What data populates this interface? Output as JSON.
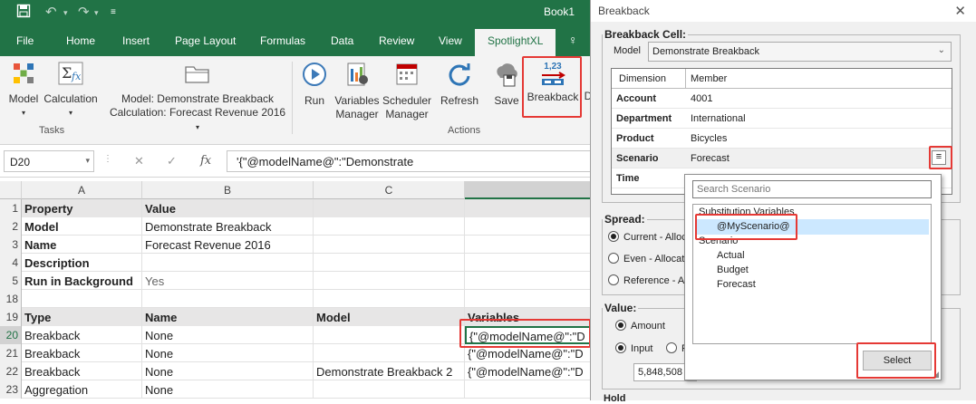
{
  "titlebar": {
    "book": "Book1"
  },
  "ribbon_tabs": [
    "File",
    "Home",
    "Insert",
    "Page Layout",
    "Formulas",
    "Data",
    "Review",
    "View",
    "SpotlightXL"
  ],
  "ribbon": {
    "model_label": "Model",
    "calculation_label": "Calculation",
    "model_info": "Model: Demonstrate Breakback",
    "calc_info": "Calculation: Forecast Revenue 2016",
    "tasks_group": "Tasks",
    "run_label": "Run",
    "variables_label1": "Variables",
    "variables_label2": "Manager",
    "scheduler_label1": "Scheduler",
    "scheduler_label2": "Manager",
    "refresh_label": "Refresh",
    "save_label": "Save",
    "breakback_label": "Breakback",
    "actions_group": "Actions",
    "d_label": "D",
    "icon_numbers": "1,23"
  },
  "formula": {
    "cell_ref": "D20",
    "fx": "fx",
    "content": "'{\"@modelName@\":\"Demonstrate"
  },
  "columns": [
    "A",
    "B",
    "C"
  ],
  "rows": [
    {
      "num": "1",
      "a": "Property",
      "b": "Value",
      "c": "",
      "d": ""
    },
    {
      "num": "2",
      "a": "Model",
      "b": "Demonstrate Breakback",
      "c": "",
      "d": ""
    },
    {
      "num": "3",
      "a": "Name",
      "b": "Forecast Revenue 2016",
      "c": "",
      "d": ""
    },
    {
      "num": "4",
      "a": "Description",
      "b": "",
      "c": "",
      "d": ""
    },
    {
      "num": "5",
      "a": "Run in Background",
      "b": "Yes",
      "c": "",
      "d": ""
    },
    {
      "num": "18",
      "a": "",
      "b": "",
      "c": "",
      "d": ""
    },
    {
      "num": "19",
      "a": "Type",
      "b": "Name",
      "c": "Model",
      "d": "Variables"
    },
    {
      "num": "20",
      "a": "Breakback",
      "b": "None",
      "c": "",
      "d": "{\"@modelName@\":\"D"
    },
    {
      "num": "21",
      "a": "Breakback",
      "b": "None",
      "c": "",
      "d": "{\"@modelName@\":\"D"
    },
    {
      "num": "22",
      "a": "Breakback",
      "b": "None",
      "c": "Demonstrate Breakback 2",
      "d": "{\"@modelName@\":\"D"
    },
    {
      "num": "23",
      "a": "Aggregation",
      "b": "None",
      "c": "",
      "d": ""
    }
  ],
  "dialog": {
    "title": "Breakback",
    "close": "✕",
    "cell_group": "Breakback Cell:",
    "model_label": "Model",
    "model_value": "Demonstrate Breakback",
    "grid_headers": [
      "Dimension",
      "Member"
    ],
    "grid_rows": [
      {
        "dim": "Account",
        "mem": "4001"
      },
      {
        "dim": "Department",
        "mem": "International"
      },
      {
        "dim": "Product",
        "mem": "Bicycles"
      },
      {
        "dim": "Scenario",
        "mem": "Forecast"
      },
      {
        "dim": "Time",
        "mem": ""
      }
    ],
    "spread_group": "Spread:",
    "spread_options": [
      "Current - Alloc",
      "Even - Allocat",
      "Reference - A"
    ],
    "value_group": "Value:",
    "amount_label": "Amount",
    "input_label": "Input",
    "f_label": "F",
    "value_input": "5,848,508",
    "bottom_partial": "Hold"
  },
  "popup": {
    "search_placeholder": "Search Scenario",
    "substitution_header": "Substitution Variables",
    "selected_item": "@MyScenario@",
    "scenario_header": "Scenario",
    "items": [
      "Actual",
      "Budget",
      "Forecast"
    ],
    "select_button": "Select"
  }
}
